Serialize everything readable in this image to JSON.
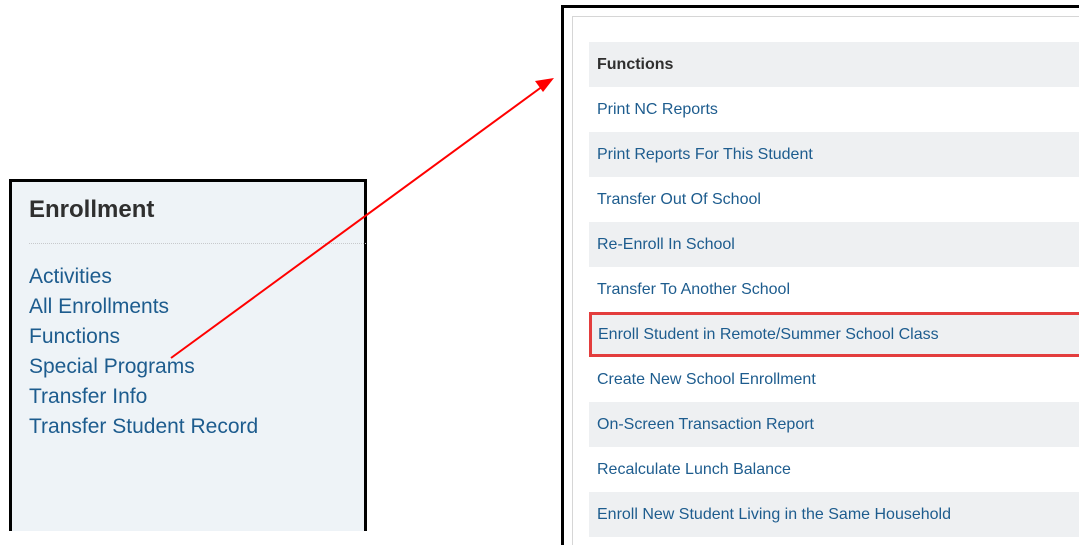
{
  "enrollment": {
    "title": "Enrollment",
    "links": [
      "Activities",
      "All Enrollments",
      "Functions",
      "Special Programs",
      "Transfer Info",
      "Transfer Student Record"
    ]
  },
  "functions": {
    "header": "Functions",
    "items": [
      "Print NC Reports",
      "Print Reports For This Student",
      "Transfer Out Of School",
      "Re-Enroll In School",
      "Transfer To Another School",
      "Enroll Student in Remote/Summer School Class",
      "Create New School Enrollment",
      "On-Screen Transaction Report",
      "Recalculate Lunch Balance",
      "Enroll New Student Living in the Same Household"
    ]
  },
  "colors": {
    "link": "#1d5c8e",
    "highlight": "#e33d3d",
    "arrow": "#ff0000",
    "panel_bg": "#eef3f7"
  }
}
